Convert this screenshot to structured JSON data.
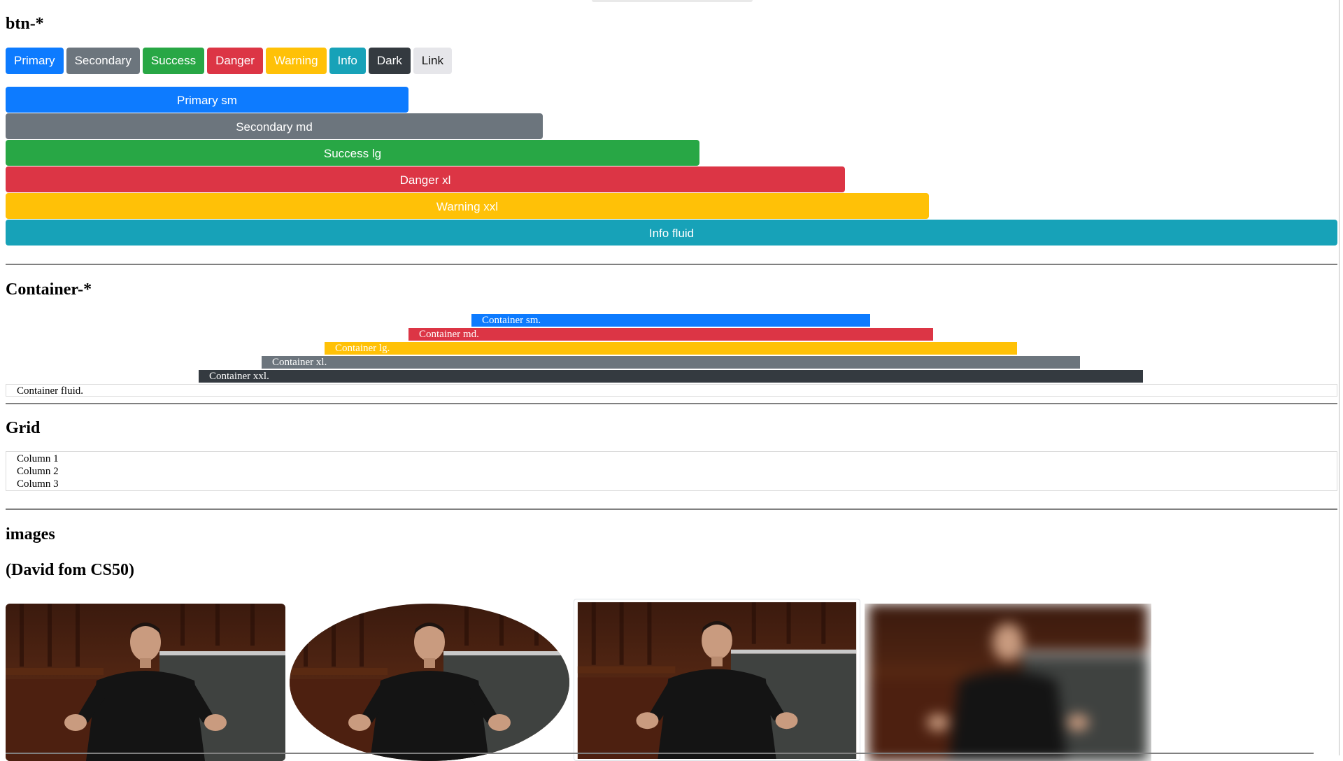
{
  "sections": {
    "btn_title": "btn-*",
    "container_title": "Container-*",
    "grid_title": "Grid",
    "images_title": "images",
    "images_subtitle": "(David fom CS50)"
  },
  "buttons": [
    {
      "label": "Primary",
      "color": "#0d7bff"
    },
    {
      "label": "Secondary",
      "color": "#6c757d"
    },
    {
      "label": "Success",
      "color": "#28a745"
    },
    {
      "label": "Danger",
      "color": "#dc3545"
    },
    {
      "label": "Warning",
      "color": "#ffc107"
    },
    {
      "label": "Info",
      "color": "#17a2b8"
    },
    {
      "label": "Dark",
      "color": "#343a40"
    },
    {
      "label": "Link",
      "color": "#e6e6ea"
    }
  ],
  "wide_buttons": [
    {
      "label": "Primary sm",
      "color": "#0d7bff"
    },
    {
      "label": "Secondary md",
      "color": "#6c757d"
    },
    {
      "label": "Success lg",
      "color": "#28a745"
    },
    {
      "label": "Danger xl",
      "color": "#dc3545"
    },
    {
      "label": "Warning xxl",
      "color": "#ffc107"
    },
    {
      "label": "Info fluid",
      "color": "#17a2b8"
    }
  ],
  "containers": [
    {
      "label": "Container sm.",
      "color": "#0d7bff"
    },
    {
      "label": "Container md.",
      "color": "#dc3545"
    },
    {
      "label": "Container lg.",
      "color": "#ffc107"
    },
    {
      "label": "Container xl.",
      "color": "#6c757d"
    },
    {
      "label": "Container xxl.",
      "color": "#343a40"
    },
    {
      "label": "Container fluid."
    }
  ],
  "grid": {
    "columns": [
      "Column 1",
      "Column 2",
      "Column 3"
    ]
  },
  "images": [
    {
      "name": "rounded"
    },
    {
      "name": "ellipse"
    },
    {
      "name": "thumbnail"
    },
    {
      "name": "blurred"
    }
  ]
}
